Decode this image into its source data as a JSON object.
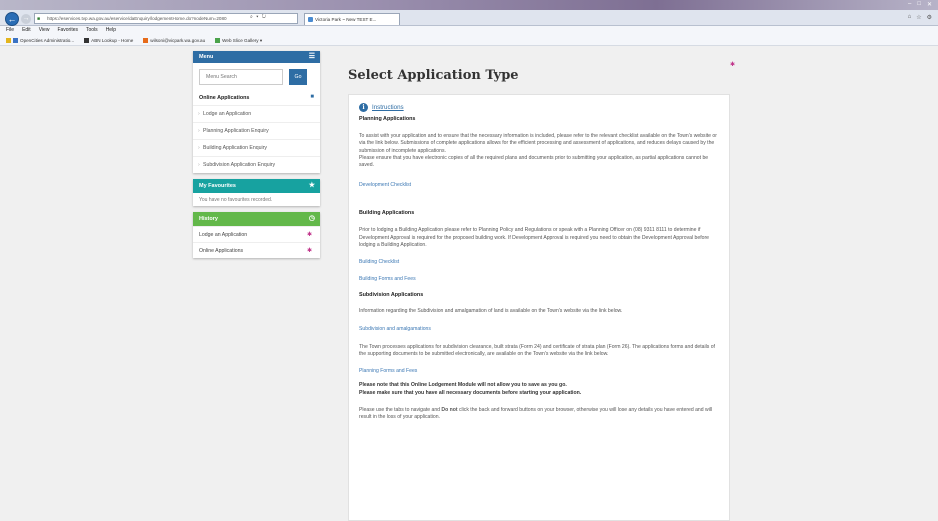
{
  "browser": {
    "url": "https://eservices.tvp.wa.gov.au/eservice/daEnquiry/lodgementHome.do?nodeNum=2080",
    "tab_title": "Victoria Park ~ New TEST E...",
    "menubar": [
      "File",
      "Edit",
      "View",
      "Favorites",
      "Tools",
      "Help"
    ],
    "favorites": [
      {
        "label": "OpenCities Administratio...",
        "icon": "page-icon"
      },
      {
        "label": "ABN Lookup - Home",
        "icon": "abn-icon"
      },
      {
        "label": "wilsoni@vicpark.wa.gov.au",
        "icon": "mail-icon"
      },
      {
        "label": "Web Slice Gallery ▾",
        "icon": "web-slice-icon"
      }
    ]
  },
  "sidebar": {
    "menu_title": "Menu",
    "search_placeholder": "Menu Search",
    "go_label": "Go",
    "section_title": "Online Applications",
    "items": [
      "Lodge an Application",
      "Planning Application Enquiry",
      "Building Application Enquiry",
      "Subdivision Application Enquiry"
    ],
    "favourites_title": "My Favourites",
    "favourites_empty": "You have no favourites recorded.",
    "history_title": "History",
    "history_items": [
      "Lodge an Application",
      "Online Applications"
    ]
  },
  "main": {
    "title": "Select Application Type",
    "instructions_link": "Instructions",
    "planning_heading": "Planning Applications",
    "planning_p1": "To assist with your application and to ensure that the necessary information is included, please refer to the relevant checklist available on the Town's website or via the link below. Submissions of complete applications allows for the efficient processing and assessment of applications, and reduces delays caused by the submission of incomplete applications.",
    "planning_p2": "Please ensure that you have electronic copies of all the required plans and documents prior to submitting your application, as partial applications cannot be saved.",
    "dev_checklist": "Development Checklist",
    "building_heading": "Building Applications",
    "building_p": "Prior to lodging a Building Application please refer to Planning Policy and Regulations or speak with a Planning Officer on (08) 9311 8111 to determine if Development Approval is required for the proposed building work. If Development Approval is required you need to obtain the Development Approval before lodging a Building Application.",
    "building_checklist": "Building Checklist",
    "building_forms": "Building Forms and Fees",
    "subdivision_heading": "Subdivision Applications",
    "subdivision_p": "Information regarding the Subdivision and amalgamation of land is available on the Town's website via the link below.",
    "subdivision_link": "Subdivision and amalgamations",
    "strata_p": "The Town processes applications for subdivision clearance, built strata (Form 24) and certificate of strata plan (Form 26). The applications forms and details of the supporting documents to be submitted electronically, are available on the Town's website via the link below.",
    "planning_forms": "Planning Forms and Fees",
    "note1": "Please note that this Online Lodgement Module will not allow you to save as you go.",
    "note2": "Please make sure that you have all necessary documents before starting your application.",
    "nav_p1": "Please use the tabs to navigate and ",
    "nav_bold": "Do not",
    "nav_p2": " click the back and forward buttons on your browser, otherwise you will lose any details you have entered and will result in the loss of your application."
  }
}
